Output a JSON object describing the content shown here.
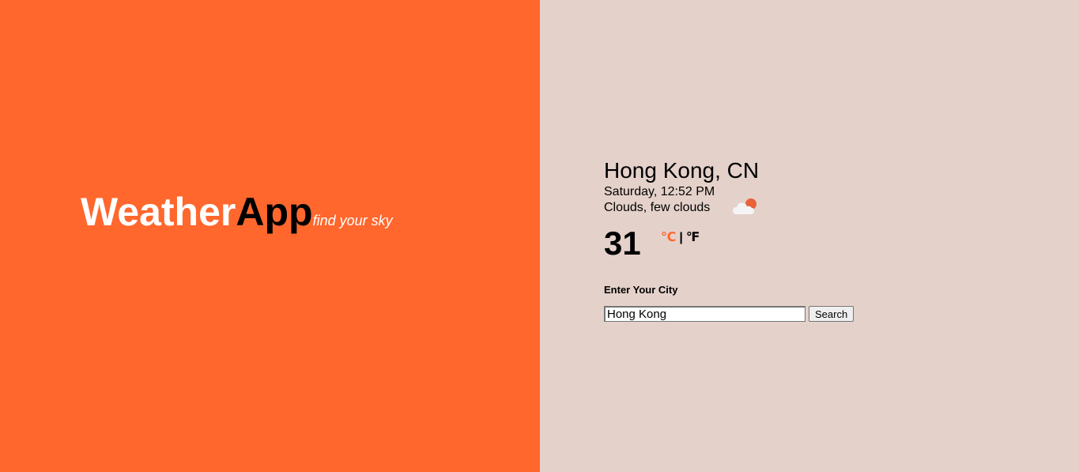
{
  "brand": {
    "weather": "Weather",
    "app": "App",
    "tagline": "find your sky"
  },
  "weather": {
    "city": "Hong Kong, CN",
    "datetime": "Saturday, 12:52 PM",
    "description": "Clouds, few clouds",
    "icon": "cloud-sun-icon",
    "temperature": "31",
    "unit_celsius": "℃",
    "unit_separator": "|",
    "unit_fahrenheit": "℉"
  },
  "search": {
    "label": "Enter Your City",
    "value": "Hong Kong",
    "button_label": "Search"
  },
  "colors": {
    "left_background": "#ff672d",
    "right_background": "#e4d1ca",
    "accent": "#ff672d"
  }
}
